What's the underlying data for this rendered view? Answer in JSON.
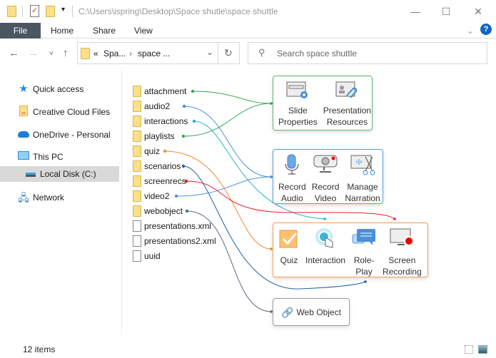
{
  "window": {
    "title": "C:\\Users\\ispring\\Desktop\\Space shutle\\space shuttle",
    "minimize": "—",
    "maximize": "☐",
    "close": "✕"
  },
  "ribbon": {
    "tabs": [
      "File",
      "Home",
      "Share",
      "View"
    ],
    "help": "?",
    "expand": "⌄"
  },
  "address": {
    "path": [
      "«",
      "Spa...",
      "›",
      "space ..."
    ],
    "dropdown": "⌄",
    "refresh": "↻"
  },
  "search": {
    "placeholder": "Search space shuttle"
  },
  "nav": {
    "back": "←",
    "forward": "→",
    "recent": "˅",
    "up": "↑"
  },
  "sidebar": {
    "items": [
      {
        "label": "Quick access",
        "icon": "star-icon"
      },
      {
        "label": "Creative Cloud Files",
        "icon": "creative-cloud-icon"
      },
      {
        "label": "OneDrive - Personal",
        "icon": "cloud-icon"
      },
      {
        "label": "This PC",
        "icon": "monitor-icon"
      },
      {
        "label": "Local Disk (C:)",
        "icon": "drive-icon",
        "selected": true
      },
      {
        "label": "Network",
        "icon": "network-icon"
      }
    ]
  },
  "files": [
    {
      "name": "attachment",
      "type": "folder",
      "color": "#3aa655"
    },
    {
      "name": "audio2",
      "type": "folder",
      "color": "#4a8fd9"
    },
    {
      "name": "interactions",
      "type": "folder",
      "color": "#29b3c9"
    },
    {
      "name": "playlists",
      "type": "folder",
      "color": "#3aa655"
    },
    {
      "name": "quiz",
      "type": "folder",
      "color": "#f08a30"
    },
    {
      "name": "scenarios",
      "type": "folder",
      "color": "#1f5fa8"
    },
    {
      "name": "screenrecs",
      "type": "folder",
      "color": "#e8202a"
    },
    {
      "name": "video2",
      "type": "folder",
      "color": "#4a8fd9"
    },
    {
      "name": "webobject",
      "type": "folder",
      "color": "#5a6a80"
    },
    {
      "name": "presentations.xml",
      "type": "file"
    },
    {
      "name": "presentations2.xml",
      "type": "file"
    },
    {
      "name": "uuid",
      "type": "file"
    }
  ],
  "groups": [
    {
      "color": "#5cb870",
      "items": [
        [
          "Slide",
          "Properties"
        ],
        [
          "Presentation",
          "Resources"
        ]
      ]
    },
    {
      "color": "#5a9ee0",
      "items": [
        [
          "Record",
          "Audio"
        ],
        [
          "Record",
          "Video"
        ],
        [
          "Manage",
          "Narration"
        ]
      ]
    },
    {
      "color": "#f5a050",
      "items": [
        [
          "Quiz",
          ""
        ],
        [
          "Interaction",
          ""
        ],
        [
          "Role-",
          "Play"
        ],
        [
          "Screen",
          "Recording"
        ]
      ]
    },
    {
      "color": "#a09aa0",
      "items": [
        [
          "Web Object",
          ""
        ]
      ]
    }
  ],
  "status": {
    "count": "12 items"
  }
}
